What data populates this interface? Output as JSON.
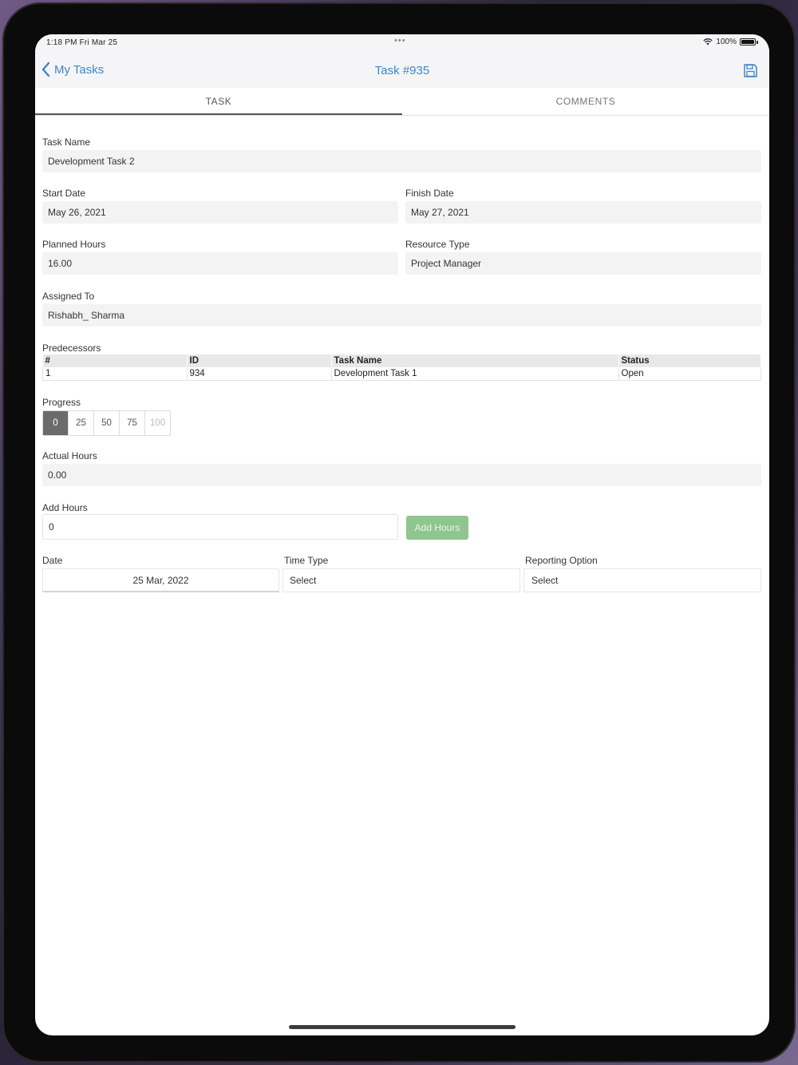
{
  "status_bar": {
    "time": "1:18 PM  Fri Mar 25",
    "dots": "•••",
    "battery": "100%"
  },
  "nav": {
    "back_label": "My Tasks",
    "title": "Task #935"
  },
  "tabs": [
    {
      "label": "TASK"
    },
    {
      "label": "COMMENTS"
    }
  ],
  "form": {
    "task_name": {
      "label": "Task Name",
      "value": "Development Task 2"
    },
    "start_date": {
      "label": "Start Date",
      "value": "May 26, 2021"
    },
    "finish_date": {
      "label": "Finish Date",
      "value": "May 27, 2021"
    },
    "planned_hours": {
      "label": "Planned Hours",
      "value": "16.00"
    },
    "resource_type": {
      "label": "Resource Type",
      "value": "Project Manager"
    },
    "assigned_to": {
      "label": "Assigned To",
      "value": "Rishabh_ Sharma"
    },
    "predecessors": {
      "label": "Predecessors",
      "columns": [
        "#",
        "ID",
        "Task Name",
        "Status"
      ],
      "rows": [
        [
          "1",
          "934",
          "Development Task 1",
          "Open"
        ]
      ]
    },
    "progress": {
      "label": "Progress",
      "options": [
        "0",
        "25",
        "50",
        "75",
        "100"
      ],
      "selected": "0"
    },
    "actual_hours": {
      "label": "Actual Hours",
      "value": "0.00"
    },
    "add_hours": {
      "label": "Add Hours",
      "value": "0",
      "button": "Add Hours"
    },
    "date": {
      "label": "Date",
      "value": "25 Mar, 2022"
    },
    "time_type": {
      "label": "Time Type",
      "value": "Select"
    },
    "reporting_option": {
      "label": "Reporting Option",
      "value": "Select"
    }
  },
  "colors": {
    "accent": "#3f86c8",
    "button_green": "#8fc58f",
    "segment_active": "#6b6b6b"
  }
}
